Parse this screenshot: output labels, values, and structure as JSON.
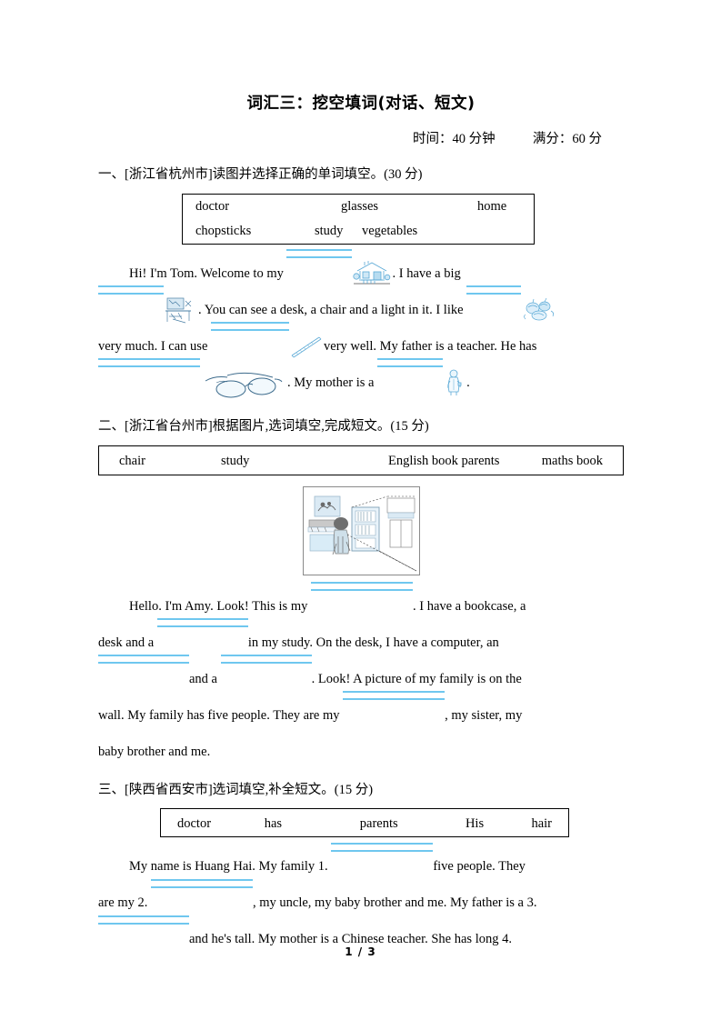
{
  "document": {
    "title": "词汇三：挖空填词(对话、短文)",
    "meta": {
      "time_label": "时间：40 分钟",
      "score_label": "满分：60 分"
    },
    "footer": "1 / 3"
  },
  "sections": [
    {
      "heading": "一、[浙江省杭州市]读图并选择正确的单词填空。(30 分)",
      "wordbank_row1": [
        "doctor",
        "glasses",
        "home"
      ],
      "wordbank_row2": [
        "chopsticks",
        "study",
        "vegetables"
      ],
      "passage": {
        "t1": "Hi! I'm Tom. Welcome to my",
        "t2": ". I have a big",
        "t3": ". You can see a desk, a chair and a light in it. I like",
        "t4": "very much. I can use",
        "t5": "very well. My father is a teacher. He has",
        "t6": ". My mother is a",
        "t7": "."
      },
      "pictures": [
        "house-picture",
        "study-room-picture",
        "vegetables-picture",
        "chopsticks-picture",
        "glasses-picture",
        "doctor-picture"
      ]
    },
    {
      "heading": "二、[浙江省台州市]根据图片,选词填空,完成短文。(15 分)",
      "wordbank": [
        "chair",
        "study",
        "English book parents",
        "maths book"
      ],
      "figure": "study-room-illustration",
      "passage": {
        "t1": "Hello. I'm Amy. Look! This is my",
        "t2": ". I have a bookcase, a",
        "t3": "desk and a",
        "t4": "in my study. On the desk, I have a computer, an",
        "t5": "and a",
        "t6": ". Look! A picture of my family is on the",
        "t7": "wall. My family has five people. They are my",
        "t8": ", my sister, my",
        "t9": "baby brother and me."
      }
    },
    {
      "heading": "三、[陕西省西安市]选词填空,补全短文。(15 分)",
      "wordbank": [
        "doctor",
        "has",
        "parents",
        "His",
        "hair"
      ],
      "passage": {
        "t1": "My name is Huang Hai. My family 1.",
        "t2": "five people. They",
        "t3": "are my 2.",
        "t4": ", my uncle, my baby brother and me. My father is a 3.",
        "t5": "and he's tall. My mother is a Chinese teacher. She has long 4."
      }
    }
  ],
  "colors": {
    "blank_rule": "#6fc7ef",
    "text": "#000000",
    "border": "#000000",
    "figure_border": "#8a8a8a"
  }
}
